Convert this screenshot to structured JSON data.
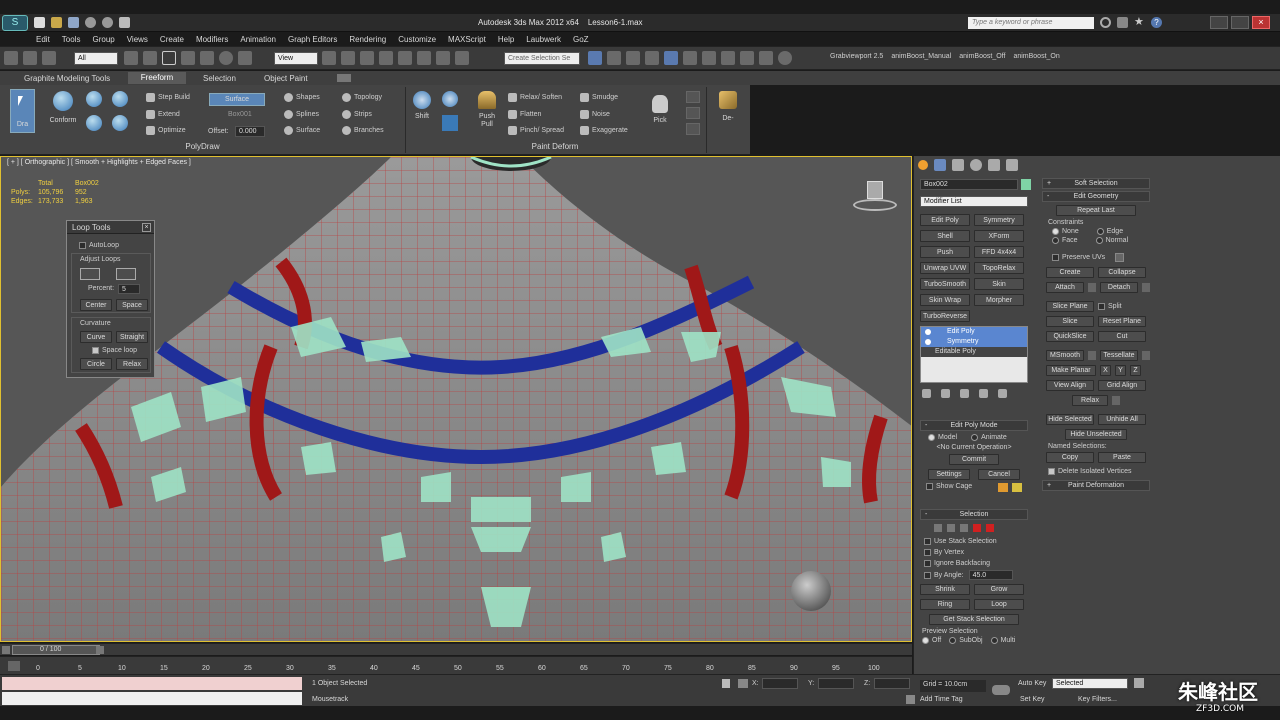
{
  "window": {
    "title": "Autodesk 3ds Max 2012 x64    Lesson6-1.max",
    "search_placeholder": "Type a keyword or phrase"
  },
  "menu": [
    "Edit",
    "Tools",
    "Group",
    "Views",
    "Create",
    "Modifiers",
    "Animation",
    "Graph Editors",
    "Rendering",
    "Customize",
    "MAXScript",
    "Help",
    "Laubwerk",
    "GoZ"
  ],
  "toolbar": {
    "filter_value": "All",
    "coord_value": "View",
    "selection_set_placeholder": "Create Selection Se",
    "plugin_labels": [
      "Grabviewport 2.5",
      "animBoost_Manual",
      "animBoost_Off",
      "animBoost_On"
    ]
  },
  "ribbon": {
    "tabs": [
      "Graphite Modeling Tools",
      "Freeform",
      "Selection",
      "Object Paint"
    ],
    "active_tab": "Freeform",
    "polydraw": {
      "draw_label": "Dra",
      "conform_label": "Conform",
      "step_build": "Step Build",
      "extend": "Extend",
      "optimize": "Optimize",
      "surface_btn": "Surface",
      "surface_obj": "Box001",
      "offset_label": "Offset:",
      "offset_value": "0.000",
      "shapes": "Shapes",
      "splines": "Splines",
      "surface": "Surface",
      "topology": "Topology",
      "strips": "Strips",
      "branches": "Branches",
      "group_label": "PolyDraw"
    },
    "paint_deform": {
      "shift": "Shift",
      "push_pull": "Push Pull",
      "relax_soften": "Relax/ Soften",
      "flatten": "Flatten",
      "pinch_spread": "Pinch/ Spread",
      "smudge": "Smudge",
      "noise": "Noise",
      "exaggerate": "Exaggerate",
      "pick": "Pick",
      "de": "De-",
      "group_label": "Paint Deform"
    }
  },
  "viewport": {
    "label": "[ + ] [ Orthographic ] [ Smooth + Highlights + Edged Faces ]",
    "stats": {
      "total_label": "Total",
      "object_label": "Box002",
      "polys_label": "Polys:",
      "polys_total": "105,796",
      "polys_obj": "952",
      "edges_label": "Edges:",
      "edges_total": "173,733",
      "edges_obj": "1,963"
    },
    "colors": {
      "bg": "#505050",
      "mesh": "#8a8a8a",
      "wire": "#c23a3a",
      "blue": "#1f2f9a",
      "red": "#a01818",
      "green": "#9fe3c6"
    }
  },
  "loop_tools": {
    "title": "Loop Tools",
    "autoloop": "AutoLoop",
    "adjust_loops": "Adjust Loops",
    "percent_label": "Percent:",
    "percent_value": "5",
    "center": "Center",
    "space": "Space",
    "curvature": "Curvature",
    "curve": "Curve",
    "straight": "Straight",
    "space_loop": "Space loop",
    "circle": "Circle",
    "relax": "Relax"
  },
  "command_panel": {
    "object_name": "Box002",
    "object_color": "#7fd3a6",
    "modifier_list": "Modifier List",
    "modifier_buttons": [
      "Edit Poly",
      "Symmetry",
      "Shell",
      "XForm",
      "Push",
      "FFD 4x4x4",
      "Unwrap UVW",
      "TopoRelax",
      "TurboSmooth",
      "Skin",
      "Skin Wrap",
      "Morpher"
    ],
    "turboreverse": "TurboReverse",
    "stack": [
      "Edit Poly",
      "Symmetry",
      "Editable Poly"
    ],
    "edit_poly_mode": {
      "title": "Edit Poly Mode",
      "model": "Model",
      "animate": "Animate",
      "no_op": "<No Current Operation>",
      "commit": "Commit",
      "settings": "Settings",
      "cancel": "Cancel",
      "show_cage": "Show Cage"
    },
    "selection": {
      "title": "Selection",
      "use_stack": "Use Stack Selection",
      "by_vertex": "By Vertex",
      "ignore_backfacing": "Ignore Backfacing",
      "by_angle": "By Angle:",
      "angle_value": "45.0",
      "shrink": "Shrink",
      "grow": "Grow",
      "ring": "Ring",
      "loop": "Loop",
      "get_stack": "Get Stack Selection",
      "preview": "Preview Selection",
      "off": "Off",
      "subobj": "SubObj",
      "multi": "Multi"
    }
  },
  "right_panel": {
    "soft_selection": "Soft Selection",
    "edit_geometry": "Edit Geometry",
    "repeat_last": "Repeat Last",
    "constraints": "Constraints",
    "none": "None",
    "edge": "Edge",
    "face": "Face",
    "normal": "Normal",
    "preserve_uvs": "Preserve UVs",
    "create": "Create",
    "collapse": "Collapse",
    "attach": "Attach",
    "detach": "Detach",
    "slice_plane": "Slice Plane",
    "split": "Split",
    "slice": "Slice",
    "reset_plane": "Reset Plane",
    "quickslice": "QuickSlice",
    "cut": "Cut",
    "msmooth": "MSmooth",
    "tessellate": "Tessellate",
    "make_planar": "Make Planar",
    "x": "X",
    "y": "Y",
    "z": "Z",
    "view_align": "View Align",
    "grid_align": "Grid Align",
    "relax": "Relax",
    "hide_selected": "Hide Selected",
    "unhide_all": "Unhide All",
    "hide_unselected": "Hide Unselected",
    "named_selections": "Named Selections:",
    "copy": "Copy",
    "paste": "Paste",
    "delete_isolated": "Delete Isolated Vertices",
    "paint_deformation": "Paint Deformation"
  },
  "timeline": {
    "frame": "0 / 100",
    "ticks": [
      "0",
      "5",
      "10",
      "15",
      "20",
      "25",
      "30",
      "35",
      "40",
      "45",
      "50",
      "55",
      "60",
      "65",
      "70",
      "75",
      "80",
      "85",
      "90",
      "95",
      "100"
    ]
  },
  "status": {
    "selected": "1 Object Selected",
    "prompt": "Mousetrack",
    "x_label": "X:",
    "y_label": "Y:",
    "z_label": "Z:",
    "grid": "Grid = 10.0cm",
    "add_time_tag": "Add Time Tag",
    "auto_key": "Auto Key",
    "set_key": "Set Key",
    "key_mode": "Selected",
    "key_filters": "Key Filters..."
  },
  "watermark": {
    "cn": "朱峰社区",
    "url": "ZF3D.COM"
  }
}
